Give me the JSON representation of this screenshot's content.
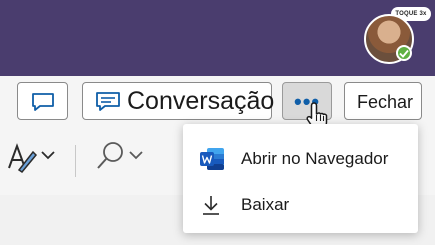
{
  "header": {
    "tooltip": "TOQUE 3x",
    "avatar_alt": "user avatar",
    "presence": "available"
  },
  "toolbar": {
    "comment_icon": "comment-icon",
    "conversation_label": "Conversação",
    "more_icon": "more-options-icon",
    "close_label": "Fechar"
  },
  "ribbon": {
    "font_tool_icon": "font-style-icon",
    "find_tool_icon": "search-icon"
  },
  "menu": {
    "items": [
      {
        "label": "Abrir no Navegador",
        "icon": "word-icon"
      },
      {
        "label": "Baixar",
        "icon": "download-icon"
      }
    ]
  },
  "colors": {
    "header_bg": "#4a3d6e",
    "accent": "#0f5ea8",
    "word_blue": "#185abd",
    "presence_green": "#5fb043"
  }
}
